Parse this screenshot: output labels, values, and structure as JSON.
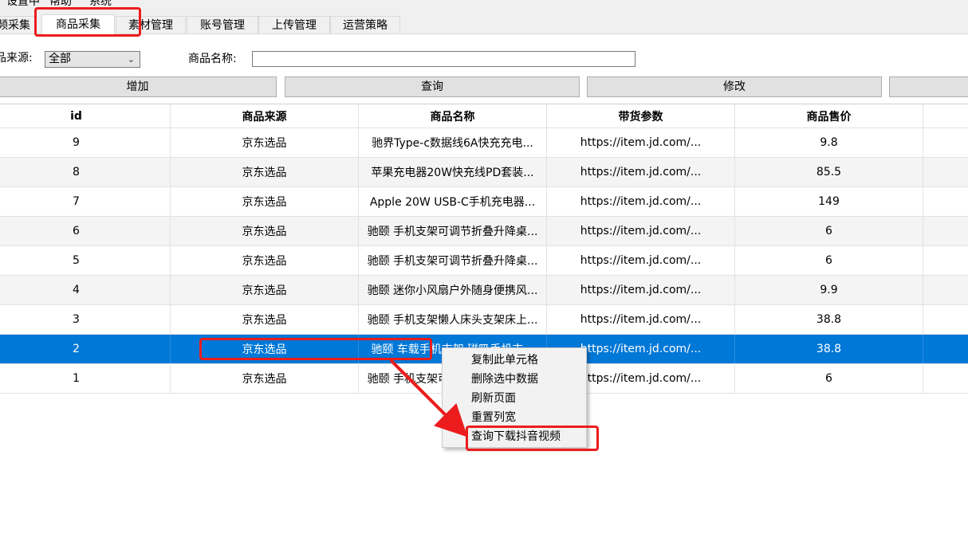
{
  "menubar": {
    "items": [
      "设置中",
      "帮助",
      "系统"
    ]
  },
  "tabs": [
    {
      "label": "频采集",
      "active": false
    },
    {
      "label": "商品采集",
      "active": true
    },
    {
      "label": "素材管理",
      "active": false
    },
    {
      "label": "账号管理",
      "active": false
    },
    {
      "label": "上传管理",
      "active": false
    },
    {
      "label": "运营策略",
      "active": false
    }
  ],
  "filters": {
    "source_label": "品来源:",
    "source_value": "全部",
    "name_label": "商品名称:",
    "name_value": ""
  },
  "buttons": {
    "add": "增加",
    "query": "查询",
    "modify": "修改",
    "extra": ""
  },
  "table": {
    "columns": [
      "id",
      "商品来源",
      "商品名称",
      "带货参数",
      "商品售价"
    ],
    "rows": [
      {
        "id": "9",
        "source": "京东选品",
        "name": "驰界Type-c数据线6A快充充电...",
        "param": "https://item.jd.com/...",
        "price": "9.8"
      },
      {
        "id": "8",
        "source": "京东选品",
        "name": "苹果充电器20W快充线PD套装...",
        "param": "https://item.jd.com/...",
        "price": "85.5"
      },
      {
        "id": "7",
        "source": "京东选品",
        "name": "Apple 20W USB-C手机充电器...",
        "param": "https://item.jd.com/...",
        "price": "149"
      },
      {
        "id": "6",
        "source": "京东选品",
        "name": "驰颐 手机支架可调节折叠升降桌...",
        "param": "https://item.jd.com/...",
        "price": "6"
      },
      {
        "id": "5",
        "source": "京东选品",
        "name": "驰颐 手机支架可调节折叠升降桌...",
        "param": "https://item.jd.com/...",
        "price": "6"
      },
      {
        "id": "4",
        "source": "京东选品",
        "name": "驰颐 迷你小风扇户外随身便携风...",
        "param": "https://item.jd.com/...",
        "price": "9.9"
      },
      {
        "id": "3",
        "source": "京东选品",
        "name": "驰颐 手机支架懒人床头支架床上...",
        "param": "https://item.jd.com/...",
        "price": "38.8"
      },
      {
        "id": "2",
        "source": "京东选品",
        "name": "驰颐 车载手机支架 磁吸手机支...",
        "param": "https://item.jd.com/...",
        "price": "38.8",
        "selected": true
      },
      {
        "id": "1",
        "source": "京东选品",
        "name": "驰颐 手机支架可调节折叠升降桌...",
        "param": "https://item.jd.com/...",
        "price": "6"
      }
    ]
  },
  "context_menu": {
    "items": [
      "复制此单元格",
      "删除选中数据",
      "刷新页面",
      "重置列宽",
      "查询下载抖音视频"
    ]
  },
  "colors": {
    "selection": "#0078d7",
    "annotation": "#ec1c1c",
    "menu_bg": "#f2f2f2"
  }
}
